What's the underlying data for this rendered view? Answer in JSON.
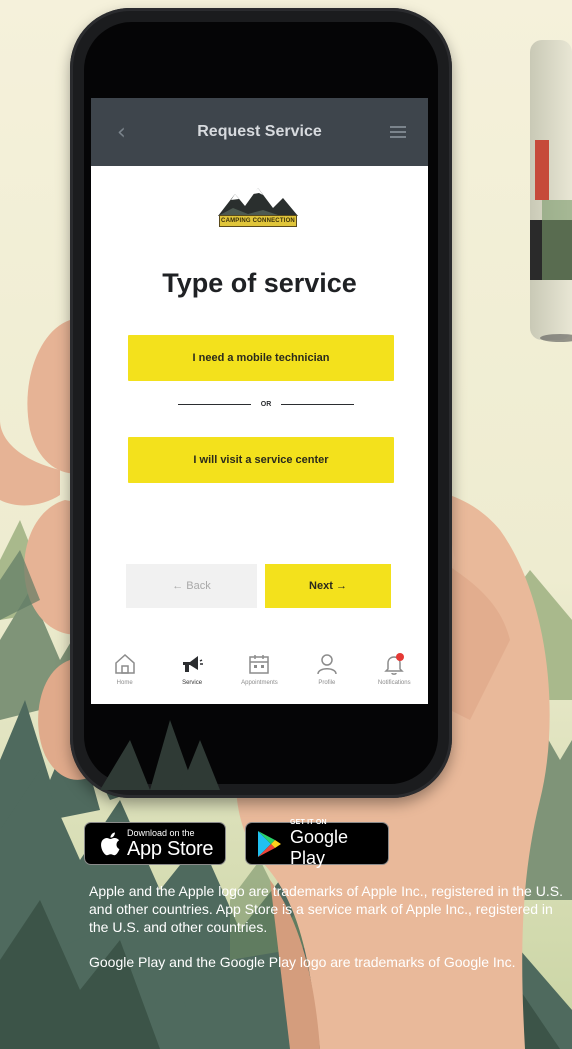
{
  "app": {
    "header_title": "Request Service",
    "logo_text": "CAMPING CONNECTION",
    "logo_subtext": "",
    "page_title": "Type of service",
    "option_mobile_label": "I need a mobile technician",
    "or_label": "OR",
    "option_center_label": "I will visit a service center",
    "back_label": "← Back",
    "next_label": "Next →",
    "tabs": [
      {
        "label": "Home",
        "icon": "home-icon"
      },
      {
        "label": "Service",
        "icon": "megaphone-icon"
      },
      {
        "label": "Appointments",
        "icon": "calendar-icon"
      },
      {
        "label": "Profile",
        "icon": "user-icon"
      },
      {
        "label": "Notifications",
        "icon": "bell-icon"
      }
    ],
    "active_tab": "Service",
    "notification_badge_color": "#e53935"
  },
  "badges": {
    "apple_small": "Download on the",
    "apple_big": "App Store",
    "google_small": "GET IT ON",
    "google_big": "Google Play"
  },
  "legal": {
    "apple_text": "Apple and the Apple logo are trademarks of Apple Inc., registered in the U.S. and other countries. App Store is a service mark of Apple Inc., registered in the U.S. and other countries.",
    "google_text": "Google Play and the Google Play logo are trademarks of Google Inc."
  },
  "colors": {
    "accent_yellow": "#f3e11c",
    "header_dark": "#3e454c",
    "background_cream": "#f3eed7",
    "forest_green": "#4f6a5e"
  }
}
